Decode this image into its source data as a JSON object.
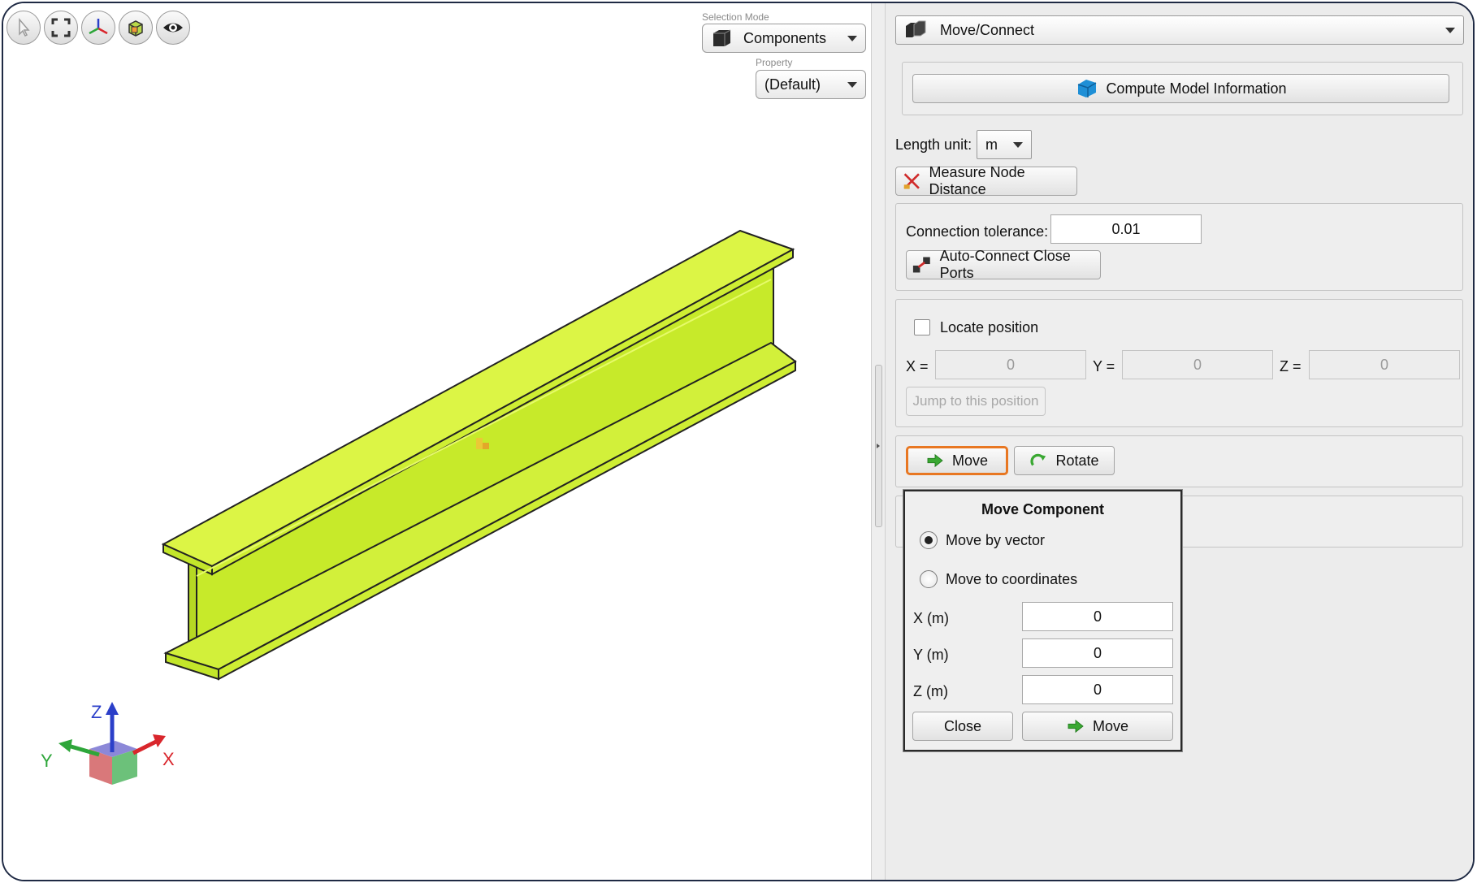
{
  "viewport": {
    "tools": [
      "select-arrow-icon",
      "fit-view-icon",
      "axes-icon",
      "view-cube-icon",
      "eye-icon"
    ],
    "selection_mode": {
      "label": "Selection Mode",
      "value": "Components"
    },
    "property": {
      "label": "Property",
      "value": "(Default)"
    },
    "triad": {
      "x": "X",
      "y": "Y",
      "z": "Z"
    },
    "beam_color": "#d4f43a"
  },
  "panel": {
    "mode_dropdown": "Move/Connect",
    "compute_button": "Compute Model Information",
    "length_unit": {
      "label": "Length unit:",
      "value": "m"
    },
    "measure_button": "Measure Node Distance",
    "connection": {
      "label": "Connection tolerance:",
      "value": "0.01",
      "auto_button": "Auto-Connect Close Ports"
    },
    "locate": {
      "checkbox_label": "Locate position",
      "x_label": "X =",
      "x_value": "0",
      "y_label": "Y =",
      "y_value": "0",
      "z_label": "Z =",
      "z_value": "0",
      "jump_button": "Jump to this position"
    },
    "move_button": "Move",
    "rotate_button": "Rotate"
  },
  "popup": {
    "title": "Move Component",
    "radio_vector": "Move by vector",
    "radio_coords": "Move to coordinates",
    "x_label": "X (m)",
    "x_value": "0",
    "y_label": "Y (m)",
    "y_value": "0",
    "z_label": "Z (m)",
    "z_value": "0",
    "close_button": "Close",
    "move_button": "Move"
  },
  "colors": {
    "accent_highlight": "#e87722",
    "arrow_green": "#3aa832",
    "triad_x": "#d9262c",
    "triad_y": "#2ea63a",
    "triad_z": "#2b3fc9"
  }
}
